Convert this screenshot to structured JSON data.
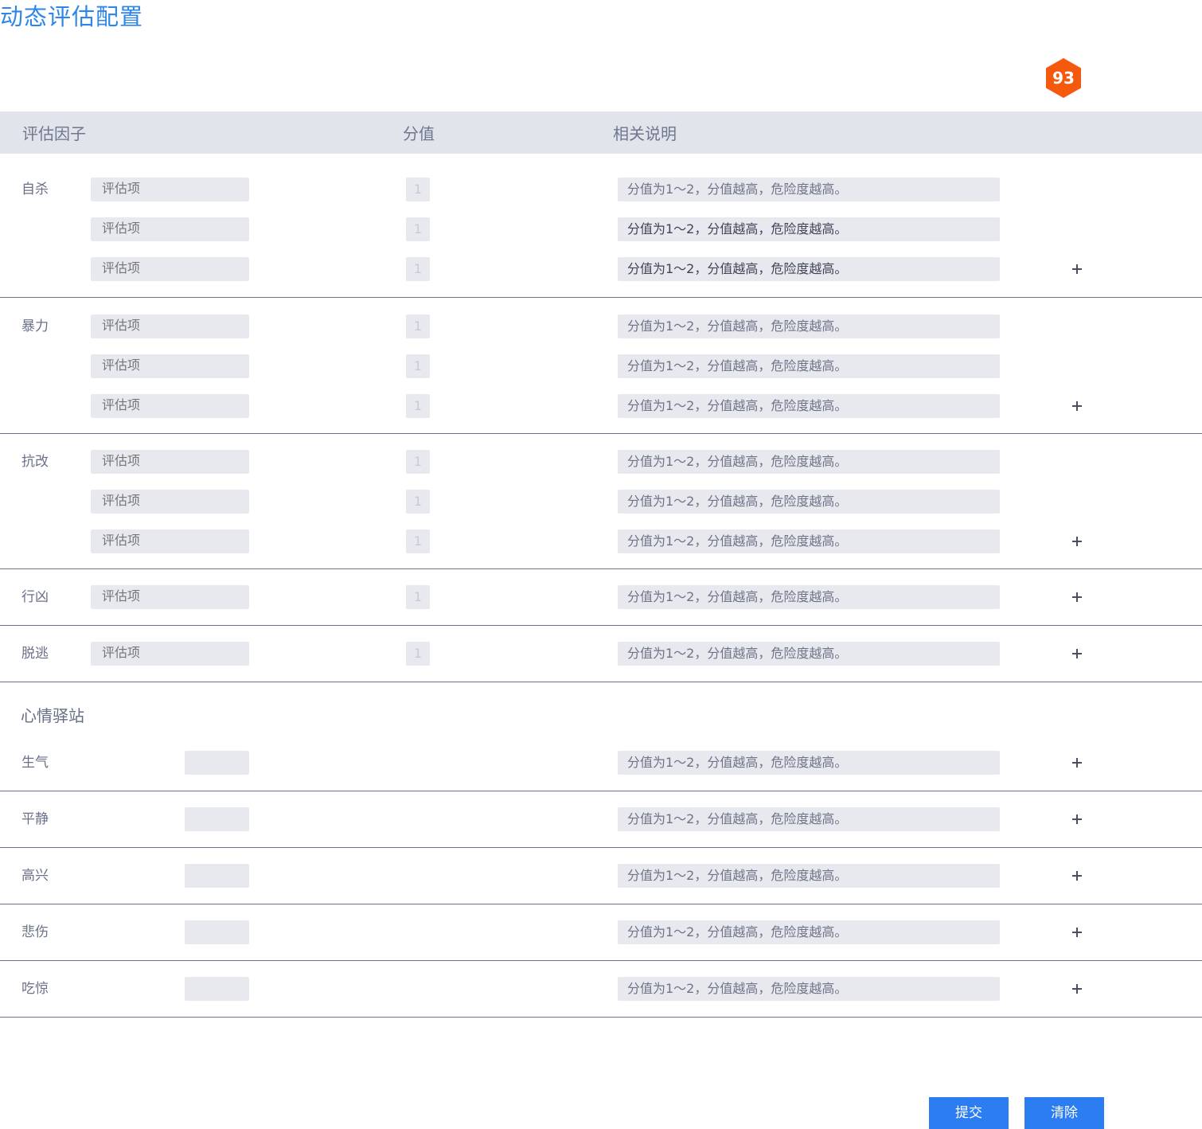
{
  "title": "动态评估配置",
  "badge": "93",
  "table_header": {
    "factor": "评估因子",
    "score": "分值",
    "description": "相关说明"
  },
  "factor_groups": [
    {
      "name": "自杀",
      "rows": [
        {
          "item_placeholder": "评估项",
          "score": "1",
          "description": "分值为1～2，分值越高，危险度越高。"
        },
        {
          "item_placeholder": "评估项",
          "score": "1",
          "description": "分值为1～2，分值越高，危险度越高。"
        },
        {
          "item_placeholder": "评估项",
          "score": "1",
          "description": "分值为1～2，分值越高，危险度越高。"
        }
      ]
    },
    {
      "name": "暴力",
      "rows": [
        {
          "item_placeholder": "评估项",
          "score": "1",
          "description": "分值为1～2，分值越高，危险度越高。"
        },
        {
          "item_placeholder": "评估项",
          "score": "1",
          "description": "分值为1～2，分值越高，危险度越高。"
        },
        {
          "item_placeholder": "评估项",
          "score": "1",
          "description": "分值为1～2，分值越高，危险度越高。"
        }
      ]
    },
    {
      "name": "抗改",
      "rows": [
        {
          "item_placeholder": "评估项",
          "score": "1",
          "description": "分值为1～2，分值越高，危险度越高。"
        },
        {
          "item_placeholder": "评估项",
          "score": "1",
          "description": "分值为1～2，分值越高，危险度越高。"
        },
        {
          "item_placeholder": "评估项",
          "score": "1",
          "description": "分值为1～2，分值越高，危险度越高。"
        }
      ]
    },
    {
      "name": "行凶",
      "rows": [
        {
          "item_placeholder": "评估项",
          "score": "1",
          "description": "分值为1～2，分值越高，危险度越高。"
        }
      ]
    },
    {
      "name": "脱逃",
      "rows": [
        {
          "item_placeholder": "评估项",
          "score": "1",
          "description": "分值为1～2，分值越高，危险度越高。"
        }
      ]
    }
  ],
  "mood_section": {
    "title": "心情驿站",
    "rows": [
      {
        "name": "生气",
        "value": "",
        "description": "分值为1～2，分值越高，危险度越高。"
      },
      {
        "name": "平静",
        "value": "",
        "description": "分值为1～2，分值越高，危险度越高。"
      },
      {
        "name": "高兴",
        "value": "",
        "description": "分值为1～2，分值越高，危险度越高。"
      },
      {
        "name": "悲伤",
        "value": "",
        "description": "分值为1～2，分值越高，危险度越高。"
      },
      {
        "name": "吃惊",
        "value": "",
        "description": "分值为1～2，分值越高，危险度越高。"
      }
    ]
  },
  "buttons": {
    "submit": "提交",
    "clear": "清除"
  },
  "icons": {
    "add": "plus-icon"
  },
  "colors": {
    "accent": "#2f86ea",
    "badge": "#f5590d",
    "button": "#2d7df2"
  }
}
